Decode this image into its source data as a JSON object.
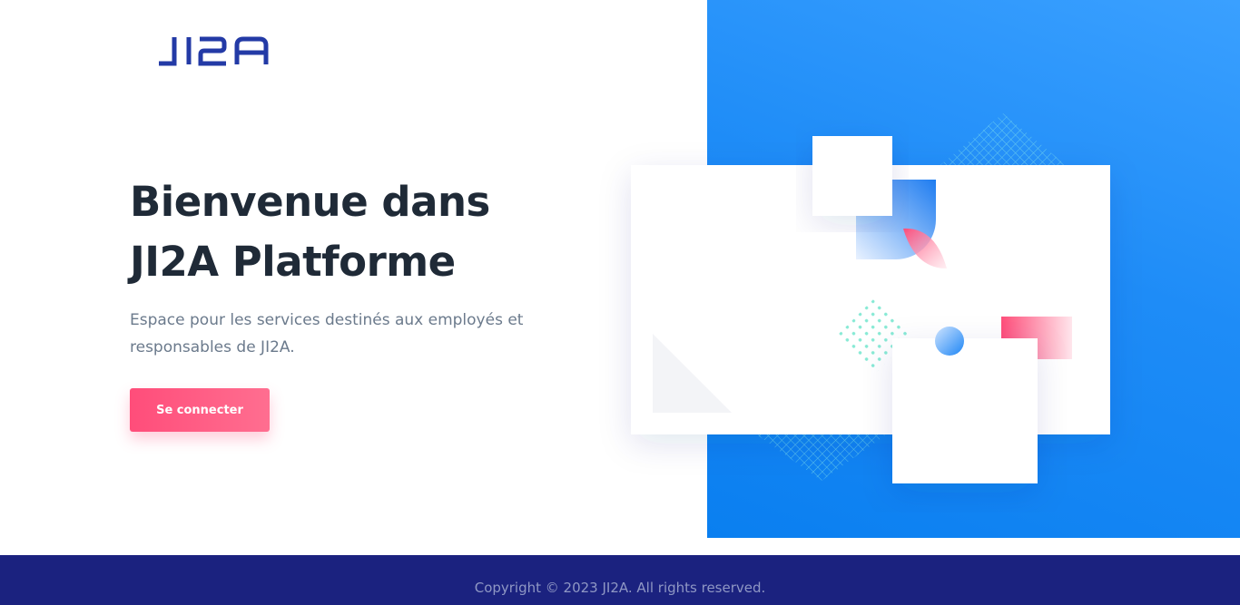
{
  "brand": {
    "logo_text": "JI2A",
    "logo_color": "#233aa6"
  },
  "hero": {
    "title_line1": "Bienvenue dans",
    "title_line2": "JI2A Platforme",
    "description": "Espace pour les services destinés aux employés et responsables de JI2A.",
    "login_label": "Se connecter"
  },
  "footer": {
    "copyright": "Copyright © 2023 JI2A. All rights reserved."
  },
  "colors": {
    "accent_pink": "#ff4d7a",
    "panel_blue": "#1e8cf7",
    "footer_navy": "#1b227f",
    "heading": "#1f2a37",
    "body_text": "#6b7a8c"
  },
  "icons": {
    "logo": "ji2a-logo-icon",
    "illustration": "abstract-shapes-illustration"
  }
}
